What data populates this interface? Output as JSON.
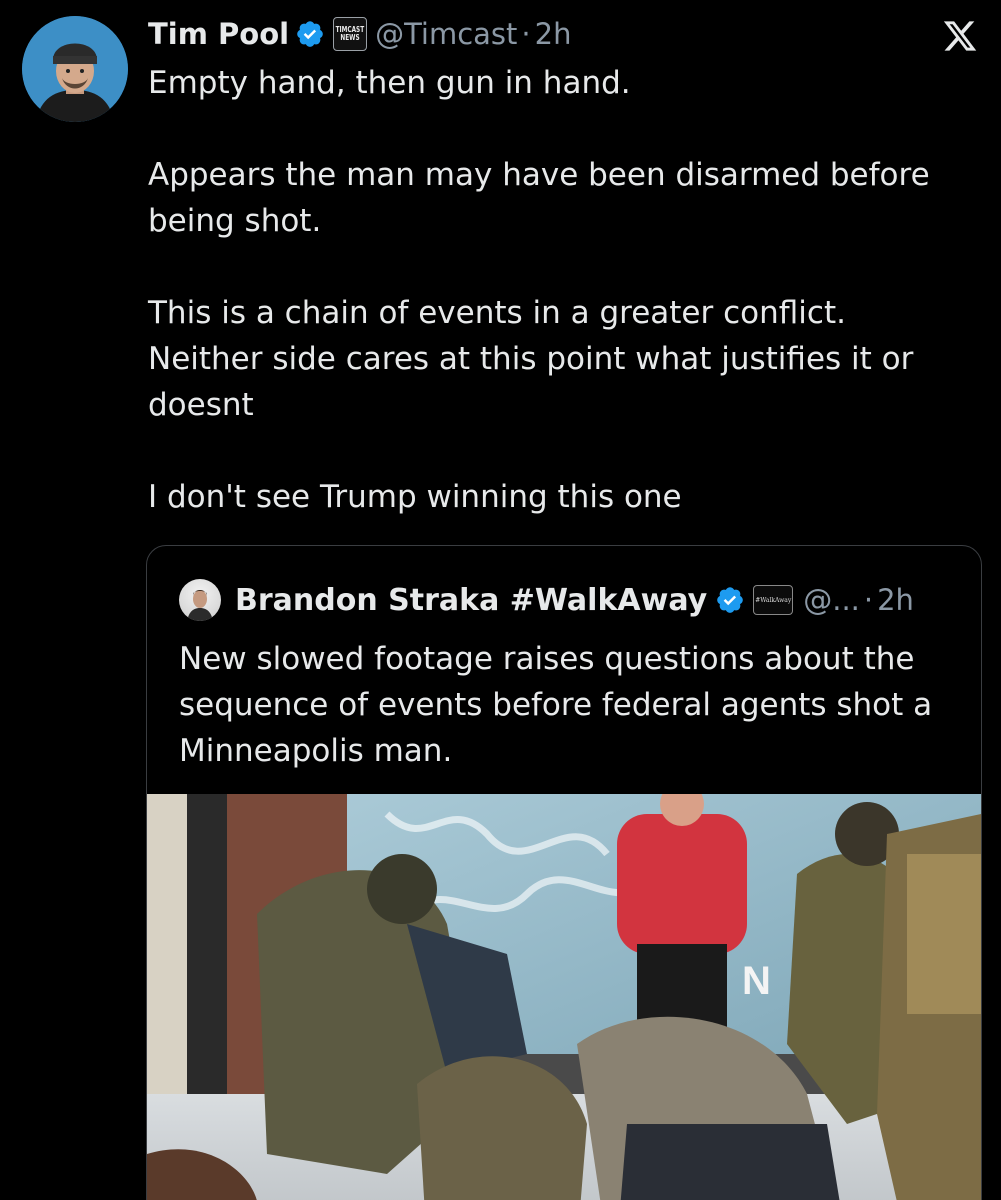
{
  "tweet": {
    "author_name": "Tim Pool",
    "affiliate_badge_lines": [
      "TIMCAST",
      "NEWS"
    ],
    "handle": "@Timcast",
    "separator": "·",
    "time": "2h",
    "paragraphs": [
      "Empty hand, then gun in hand.",
      "Appears the man may have been disarmed before being shot.",
      "This is a chain of events in a greater conflict. Neither side cares at this point what justifies it or doesnt",
      "I don't see Trump winning this one"
    ]
  },
  "quoted_tweet": {
    "author_name": "Brandon Straka #WalkAway",
    "affiliate_badge": "#WalkAway",
    "handle": "@...",
    "separator": "·",
    "time": "2h",
    "text": "New slowed footage raises questions about the sequence of events before federal agents shot a Minneapolis man.",
    "media_overlay_text": "N"
  },
  "icons": {
    "brand": "x-logo-icon",
    "verified": "verified-badge-icon"
  },
  "colors": {
    "background": "#000000",
    "text": "#e7e9ea",
    "secondary_text": "#8b98a5",
    "verified_blue": "#1d9bf0",
    "quote_border": "#3a3d41"
  }
}
